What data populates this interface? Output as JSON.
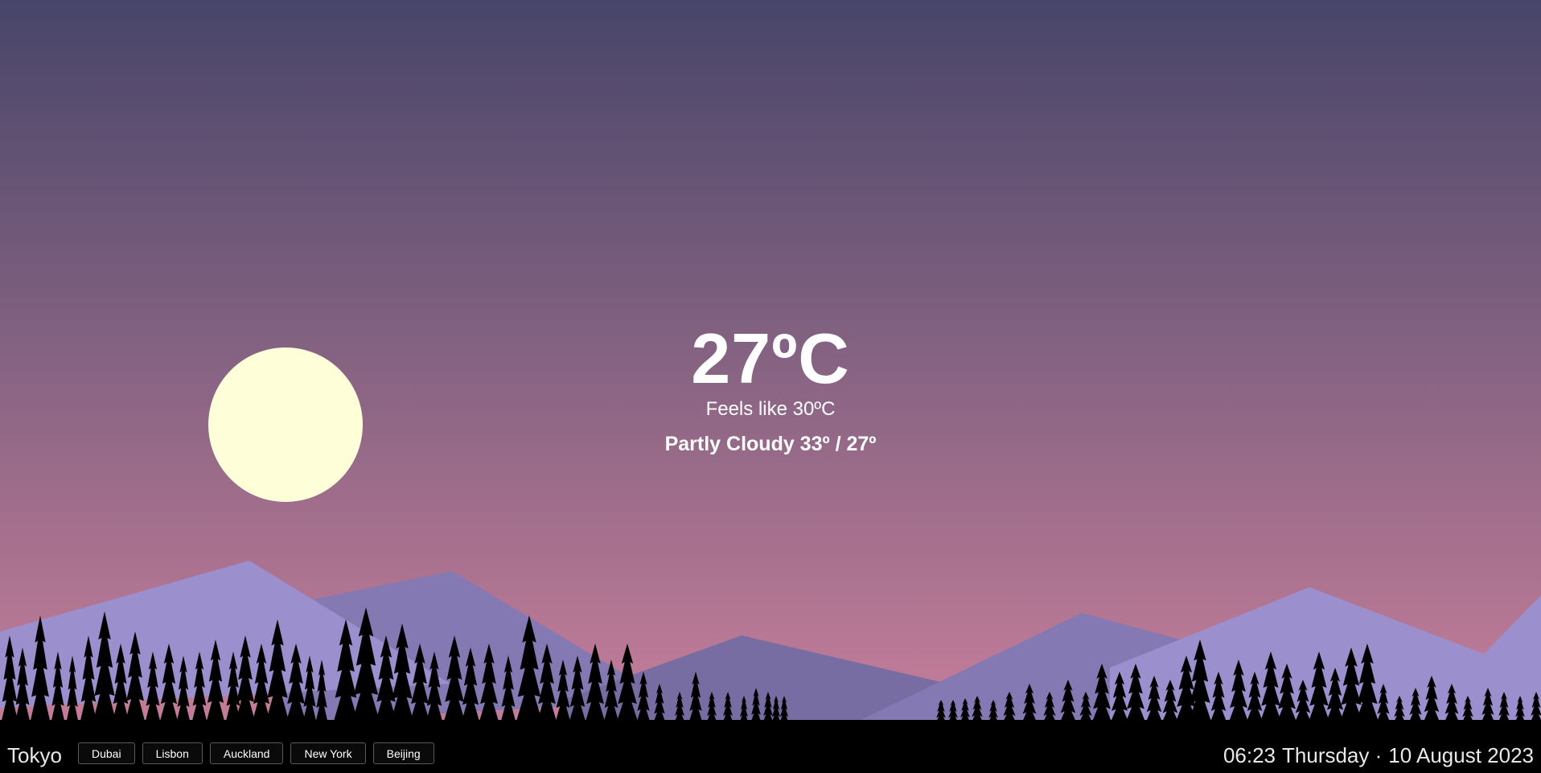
{
  "weather": {
    "temperature": "27ºC",
    "feels_like": "Feels like 30ºC",
    "summary": "Partly Cloudy 33º / 27º"
  },
  "location": {
    "current_city": "Tokyo",
    "city_buttons": [
      "Dubai",
      "Lisbon",
      "Auckland",
      "New York",
      "Beijing"
    ]
  },
  "clock": {
    "time": "06:23",
    "separator": "Thursday ·",
    "date": "10 August 2023"
  },
  "colors": {
    "sky_top": "#474569",
    "sky_mid": "#8b6584",
    "sky_bottom": "#c17c98",
    "sun": "#fefed8",
    "mountain_light": "#9b8fcd",
    "mountain_dark": "#8579b3",
    "mountain_darkest": "#776da3",
    "trees": "#000000"
  }
}
